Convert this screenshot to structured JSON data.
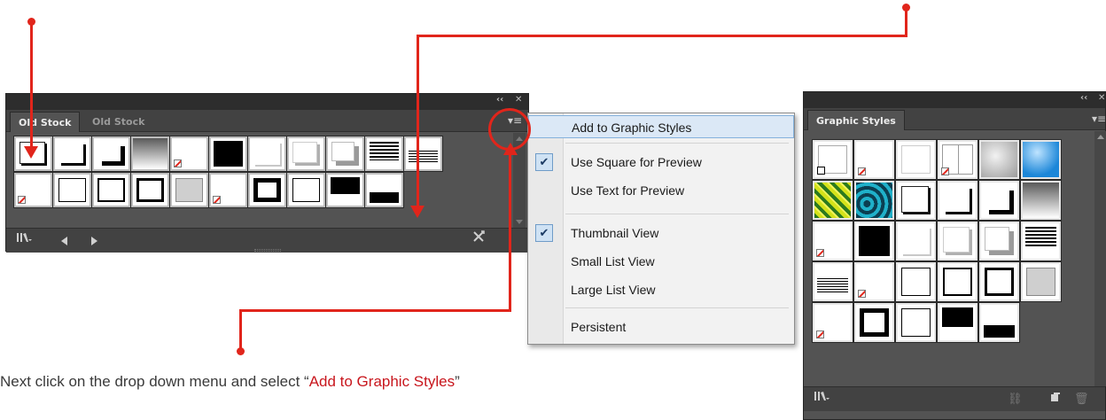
{
  "left_panel": {
    "tabs": [
      "Old Stock",
      "Old Stock"
    ],
    "top_controls": [
      "‹‹",
      "✕"
    ],
    "menu_button": "▾≡",
    "bottom_icons": [
      "library-icon",
      "prev-arrow-icon",
      "next-arrow-icon",
      "delete-icon"
    ],
    "rows": [
      [
        "shadow-br",
        "shadow-br-lg",
        "shadow-br-xl",
        "gradient",
        "none",
        "black",
        "bevel-1",
        "bevel-2",
        "bevel-3",
        "lines",
        "lines-small"
      ],
      [
        "none",
        "border-1",
        "border-2",
        "border-3",
        "gray",
        "none",
        "border-4",
        "border-1",
        "black-top",
        "black-bottom"
      ]
    ]
  },
  "graphic_styles_panel": {
    "title": "Graphic Styles",
    "top_controls": [
      "‹‹",
      "✕"
    ],
    "menu_button": "▾≡",
    "bottom_icons": [
      "library-icon",
      "break-link-icon",
      "new-style-icon",
      "trash-icon"
    ],
    "rows": [
      [
        "default",
        "none",
        "white",
        "none-split",
        "gray-soft",
        "blue-glow"
      ],
      [
        "green-swirl",
        "teal-swirl",
        "shadow-br",
        "shadow-br-lg",
        "shadow-br-xl",
        "gradient"
      ],
      [
        "none",
        "black",
        "bevel-1",
        "bevel-2",
        "bevel-3",
        "lines"
      ],
      [
        "lines-small",
        "none",
        "border-1",
        "border-2",
        "border-3",
        "gray"
      ],
      [
        "none",
        "border-4",
        "border-1",
        "black-top",
        "black-bottom"
      ]
    ]
  },
  "menu": {
    "items": [
      {
        "label": "Add to Graphic Styles",
        "checked": false,
        "highlighted": true
      },
      {
        "label": "Use Square for Preview",
        "checked": true,
        "highlighted": false
      },
      {
        "label": "Use Text for Preview",
        "checked": false,
        "highlighted": false
      },
      {
        "label": "Thumbnail View",
        "checked": true,
        "highlighted": false
      },
      {
        "label": "Small List View",
        "checked": false,
        "highlighted": false
      },
      {
        "label": "Large List View",
        "checked": false,
        "highlighted": false
      },
      {
        "label": "Persistent",
        "checked": false,
        "highlighted": false
      }
    ]
  },
  "caption": {
    "prefix": "Next click on the drop down menu and select “",
    "highlight": "Add to Graphic Styles",
    "suffix": "”"
  },
  "colors": {
    "annotation_red": "#e1251b",
    "panel_bg": "#535353",
    "menu_highlight": "#dbe8f6"
  }
}
